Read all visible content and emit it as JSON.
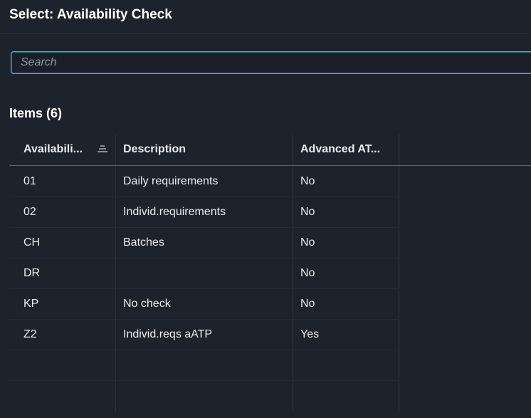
{
  "dialog": {
    "title": "Select: Availability Check"
  },
  "search": {
    "placeholder": "Search",
    "value": ""
  },
  "items": {
    "title": "Items (6)"
  },
  "table": {
    "columns": [
      {
        "label": "Availabili..."
      },
      {
        "label": "Description"
      },
      {
        "label": "Advanced AT..."
      }
    ],
    "rows": [
      {
        "code": "01",
        "description": "Daily requirements",
        "advanced_atp": "No"
      },
      {
        "code": "02",
        "description": "Individ.requirements",
        "advanced_atp": "No"
      },
      {
        "code": "CH",
        "description": "Batches",
        "advanced_atp": "No"
      },
      {
        "code": "DR",
        "description": "",
        "advanced_atp": "No"
      },
      {
        "code": "KP",
        "description": "No check",
        "advanced_atp": "No"
      },
      {
        "code": "Z2",
        "description": "Individ.reqs aATP",
        "advanced_atp": "Yes"
      }
    ]
  },
  "icons": {
    "sort": "sort-icon"
  }
}
